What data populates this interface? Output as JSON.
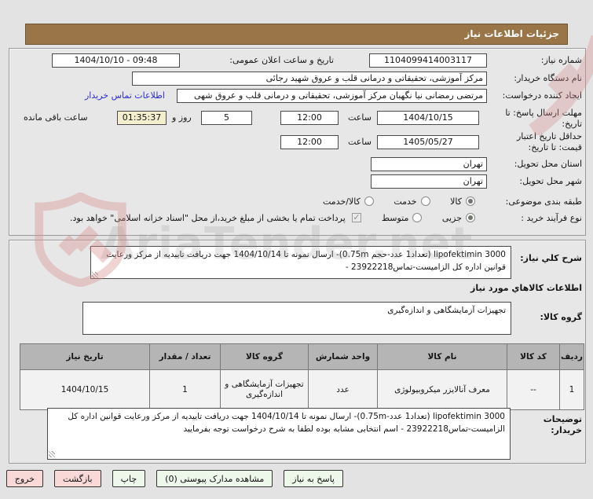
{
  "title": "جزئیات اطلاعات نیاز",
  "colors": {
    "titlebar": "#997547",
    "countdown_bg": "#f3eecd",
    "link": "#2b2bd5",
    "button_green": "#eef8ea",
    "button_pink": "#f8d9d7",
    "table_header_bg": "#b5b5b5",
    "watermark_red": "#d88f8f"
  },
  "form": {
    "need_number": {
      "label": "شماره نیاز:",
      "value": "1104099414003117"
    },
    "announce_datetime": {
      "label": "تاریخ و ساعت اعلان عمومی:",
      "value": "1404/10/10 - 09:48"
    },
    "buyer_org": {
      "label": "نام دستگاه خریدار:",
      "value": "مرکز آموزشی، تحقیقاتی و درمانی قلب و عروق شهید رجائی"
    },
    "request_creator": {
      "label": "ایجاد کننده درخواست:",
      "value": "مرتضی رمضانی نیا نگهبان مرکز آموزشی، تحقیقاتی و درمانی قلب و عروق شهی",
      "contact_link": "اطلاعات تماس خریدار"
    },
    "reply_deadline": {
      "label": "مهلت ارسال پاسخ: تا تاریخ:",
      "date": "1404/10/15",
      "hour_label": "ساعت",
      "time": "12:00",
      "days_left": "5",
      "days_label": "روز و",
      "countdown": "01:35:37",
      "remaining_label": "ساعت باقی مانده"
    },
    "price_validity": {
      "label": "حداقل تاریخ اعتبار قیمت: تا تاریخ:",
      "date": "1405/05/27",
      "hour_label": "ساعت",
      "time": "12:00"
    },
    "province": {
      "label": "استان محل تحویل:",
      "value": "تهران"
    },
    "city": {
      "label": "شهر محل تحویل:",
      "value": "تهران"
    },
    "classification": {
      "label": "طبقه بندی موضوعی:",
      "options": [
        {
          "label": "کالا",
          "selected": true
        },
        {
          "label": "خدمت",
          "selected": false
        },
        {
          "label": "کالا/خدمت",
          "selected": false
        }
      ]
    },
    "process_type": {
      "label": "نوع فرآیند خرید :",
      "options": [
        {
          "label": "جزیی",
          "selected": true
        },
        {
          "label": "متوسط",
          "selected": false
        }
      ],
      "treasury_note": "پرداخت تمام یا بخشی از مبلغ خرید،از محل \"اسناد خزانه اسلامی\" خواهد بود."
    }
  },
  "need_description": {
    "label": "شرح کلي نیاز:",
    "value": "lipofektimin 3000 (تعداد1 عدد-حجم 0.75m)- ارسال نمونه تا 1404/10/14 جهت دریافت تاییدیه از مرکز ورعایت قوانین اداره کل الزامیست-تماس23922218 -"
  },
  "goods_section": {
    "header": "اطلاعات کالاهاي مورد نیاز",
    "group_label": "گروه کالا:",
    "group_value": "تجهیزات آزمایشگاهی و اندازه‌گیری"
  },
  "table": {
    "headers": [
      "ردیف",
      "کد کالا",
      "نام کالا",
      "واحد شمارش",
      "گروه کالا",
      "تعداد / مقدار",
      "تاریخ نیاز"
    ],
    "rows": [
      {
        "cells": [
          "1",
          "--",
          "معرف آنالایزر میکروبیولوژی",
          "عدد",
          "تجهیزات آزمایشگاهی و اندازه‌گیری",
          "1",
          "1404/10/15"
        ]
      }
    ]
  },
  "buyer_notes": {
    "label": "توضیحات خریدار:",
    "value": "lipofektimin 3000 (تعداد1 عدد-0.75m)- ارسال نمونه تا 1404/10/14 جهت دریافت تاییدیه از مرکز ورعایت قوانین اداره کل الزامیست-تماس23922218 - اسم انتخابی مشابه بوده لطفا به شرح درخواست توجه بفرمایید"
  },
  "buttons": [
    {
      "label": "پاسخ به نیاز",
      "style": "green"
    },
    {
      "label": "مشاهده مدارک پیوستی (0)",
      "style": "green"
    },
    {
      "label": "چاپ",
      "style": "green"
    },
    {
      "label": "بازگشت",
      "style": "pink"
    },
    {
      "label": "خروج",
      "style": "pink"
    }
  ],
  "watermark": {
    "text": "AriaTender.net"
  }
}
